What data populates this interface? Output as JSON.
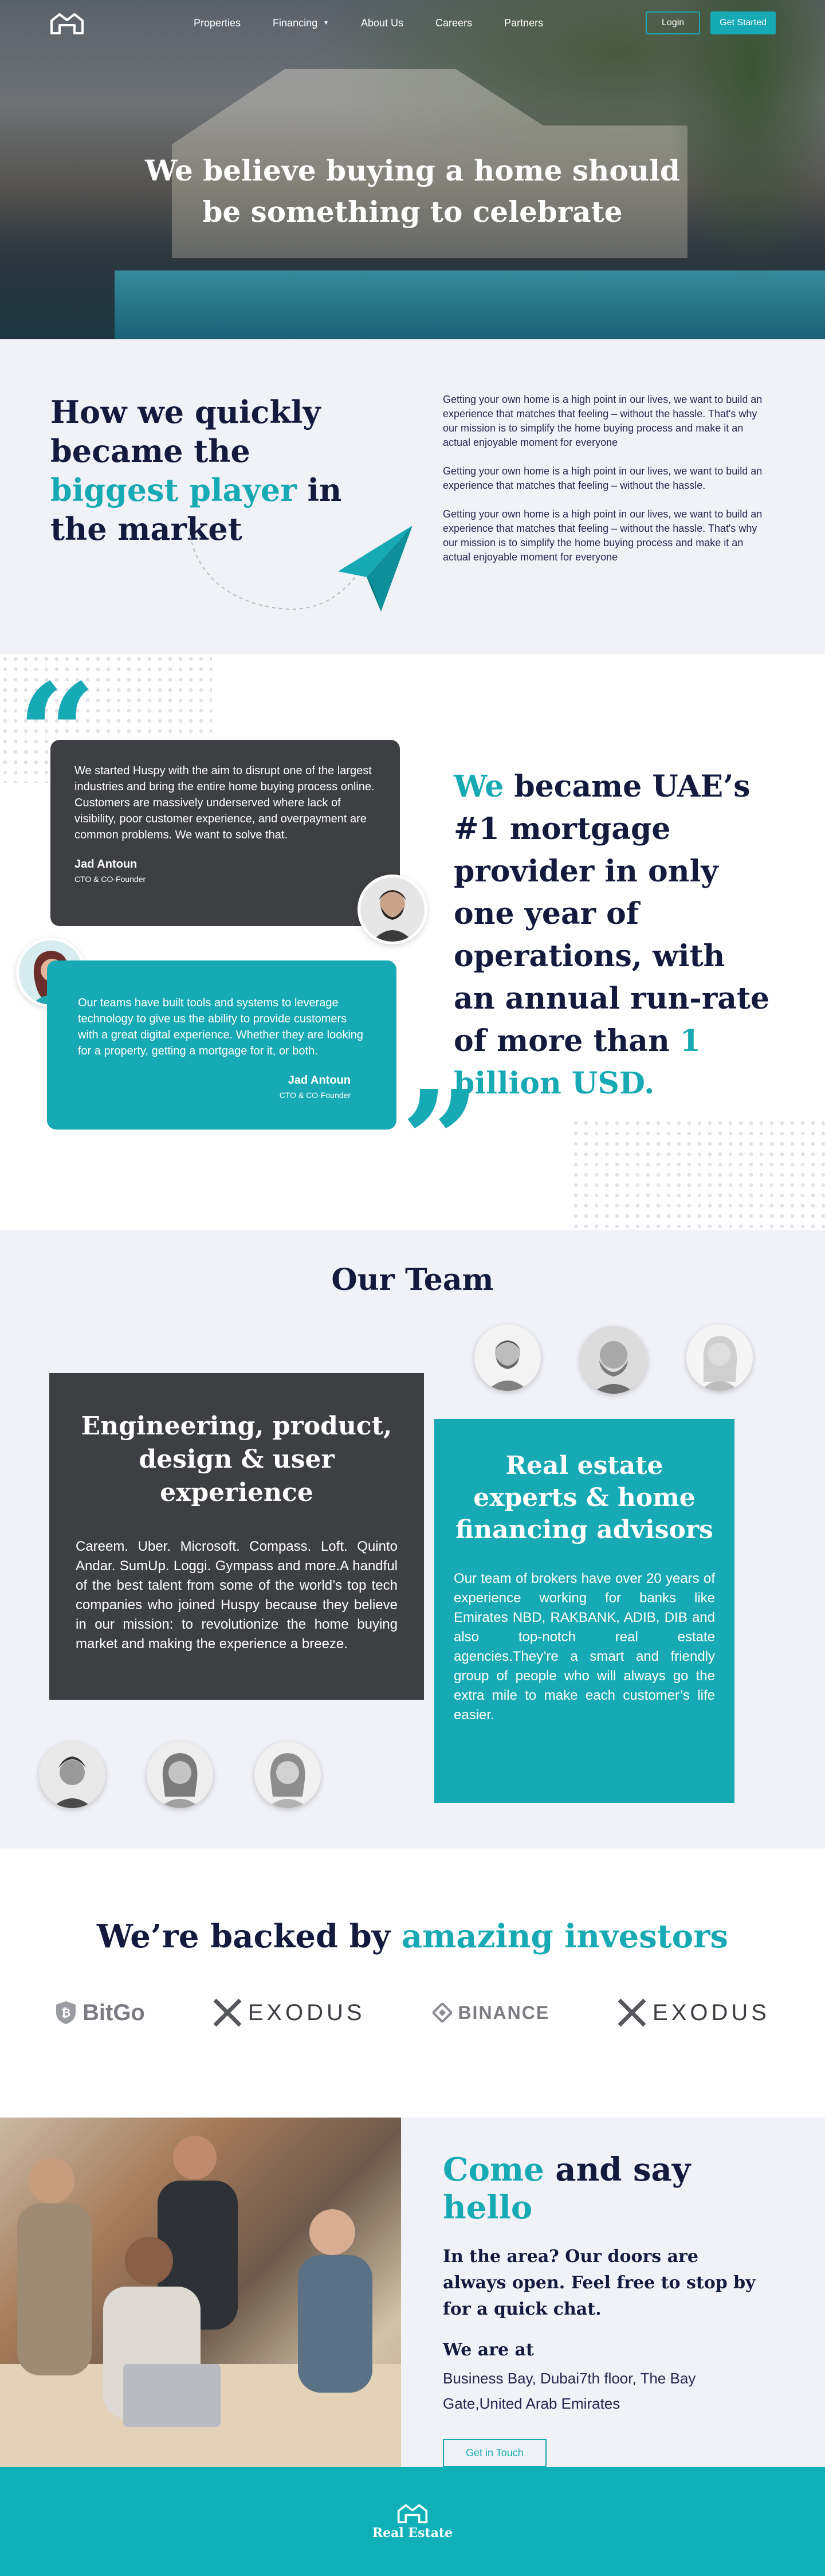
{
  "nav": {
    "items": [
      {
        "label": "Properties"
      },
      {
        "label": "Financing"
      },
      {
        "label": "About Us"
      },
      {
        "label": "Careers"
      },
      {
        "label": "Partners"
      }
    ],
    "login_label": "Login",
    "start_label": "Get Started"
  },
  "hero": {
    "line1": "We believe buying a home should",
    "line2": "be something to celebrate"
  },
  "how": {
    "title_a": "How we quickly became the ",
    "title_b": "biggest player",
    "title_c": " in the market",
    "paragraphs": [
      "Getting your own home is a high point in our lives, we want to build an experience that matches that feeling – without the hassle. That's why our mission is to simplify the home buying process and make it an actual enjoyable moment for everyone",
      "Getting your own home is a high point in our lives, we want to build an experience that matches that feeling – without the hassle.",
      "Getting your own home is a high point in our lives, we want to build an experience that matches that feeling – without the hassle. That's why our mission is to simplify the home buying process and make it an actual enjoyable moment for everyone"
    ]
  },
  "testimonials": [
    {
      "text": "We started Huspy with the aim to disrupt one of the largest industries and bring the entire home buying process online. Customers are massively underserved where lack of visibility, poor customer experience, and overpayment are common problems. We want to solve that.",
      "name": "Jad Antoun",
      "role": "CTO & CO-Founder"
    },
    {
      "text": "Our teams have built tools and systems to leverage technology to give us the ability to provide customers with a great digital experience. Whether they are looking for a property, getting a mortgage for it, or both.",
      "name": "Jad Antoun",
      "role": "CTO & CO-Founder"
    }
  ],
  "uae": {
    "we": "We",
    "mid": " became UAE’s #1 mortgage provider in only one year of operations, with an annual run-rate of more than ",
    "amount": "1 billion USD."
  },
  "team": {
    "title": "Our Team",
    "eng_title": "Engineering, product, design & user experience",
    "eng_text": "Careem. Uber. Microsoft. Compass. Loft. Quinto Andar. SumUp. Loggi. Gympass and more.A handful of the best talent from some of the world’s top tech companies who joined Huspy because they believe in our mission: to revolutionize the home buying market and making the experience a breeze.",
    "re_title": "Real estate experts & home financing advisors",
    "re_text": "Our team of brokers have over 20 years of experience working for banks like Emirates NBD, RAKBANK, ADIB, DIB and also top-notch real estate agencies.They’re a smart and friendly group of people who will always go the extra mile to make each customer’s life easier."
  },
  "investors": {
    "title_a": "We’re backed by ",
    "title_b": "amazing investors",
    "logos": [
      "BitGo",
      "EXODUS",
      "BINANCE",
      "EXODUS"
    ]
  },
  "contact": {
    "title_a": "Come",
    "title_b": " and say ",
    "title_c": "hello",
    "lead": "In the area? Our doors are always open. Feel free to stop by for a quick chat.",
    "we_are_at": "We are at",
    "address": "Business Bay, Dubai7th floor, The Bay Gate,United Arab Emirates",
    "button": "Get in Touch"
  },
  "footer": {
    "name": "Real Estate"
  },
  "colors": {
    "accent": "#17a9b4",
    "navy": "#131a3d",
    "dark_card": "#3d3f42",
    "section_bg": "#f1f2f7"
  }
}
